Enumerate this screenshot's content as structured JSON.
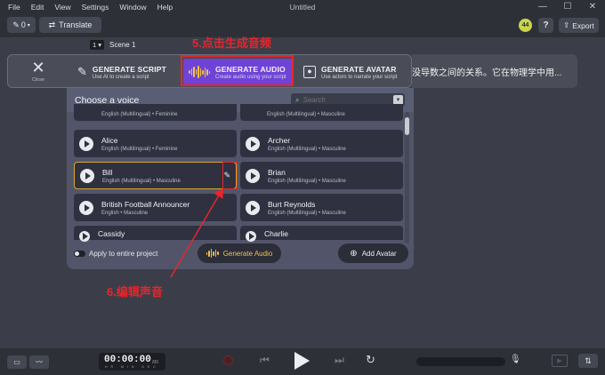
{
  "menu": [
    "File",
    "Edit",
    "View",
    "Settings",
    "Window",
    "Help"
  ],
  "window_title": "Untitled",
  "window_controls": [
    "—",
    "☐",
    "✕"
  ],
  "toolbar": {
    "pen_count": "0",
    "translate_label": "Translate",
    "avatar_initials": "44",
    "help_label": "?",
    "export_label": "Export"
  },
  "scene": {
    "number": "1",
    "label": "Scene 1"
  },
  "annotations": {
    "step5": "5.点击生成音频",
    "step6": "6.编辑声音",
    "color": "#e8252b"
  },
  "modes": {
    "close_label": "Close",
    "script": {
      "title": "GENERATE SCRIPT",
      "subtitle": "Use AI to create a script"
    },
    "audio": {
      "title": "GENERATE AUDIO",
      "subtitle": "Create audio using your script"
    },
    "avatar": {
      "title": "GENERATE AVATAR",
      "subtitle": "Use actors to narrate your script"
    }
  },
  "script_preview": "没导数之间的关系。它在物理学中用...",
  "voice_panel": {
    "title": "Choose a voice",
    "search_placeholder": "Search",
    "voices": [
      {
        "name": "",
        "desc": "English (Multilingual) • Feminine"
      },
      {
        "name": "",
        "desc": "English (Multilingual) • Masculine"
      },
      {
        "name": "Alice",
        "desc": "English (Multilingual) • Feminine"
      },
      {
        "name": "Archer",
        "desc": "English (Multilingual) • Masculine"
      },
      {
        "name": "Bill",
        "desc": "English (Multilingual) • Masculine"
      },
      {
        "name": "Brian",
        "desc": "English (Multilingual) • Masculine"
      },
      {
        "name": "British Football Announcer",
        "desc": "English • Masculine"
      },
      {
        "name": "Burt Reynolds",
        "desc": "English (Multilingual) • Masculine"
      },
      {
        "name": "Cassidy",
        "desc": ""
      },
      {
        "name": "Charlie",
        "desc": ""
      }
    ],
    "apply_label": "Apply to entire project",
    "generate_label": "Generate Audio",
    "add_avatar_label": "Add Avatar"
  },
  "transport": {
    "timecode": "00:00:00",
    "frames": "/00",
    "units": "HR MIN SEC"
  }
}
